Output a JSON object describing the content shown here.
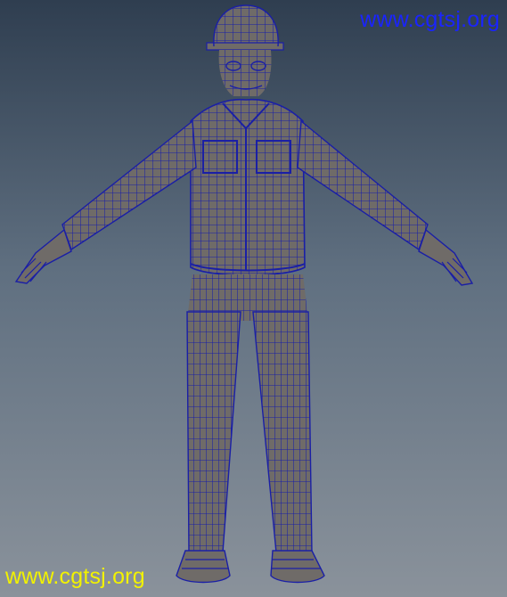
{
  "watermarks": {
    "top": "www.cgtsj.org",
    "bottom": "www.cgtsj.org"
  },
  "colors": {
    "background_top": "#2f3e50",
    "background_bottom": "#8a929b",
    "mesh_fill": "#6f6b68",
    "wireframe": "#1a1fa6",
    "watermark_top": "#1a24ff",
    "watermark_bottom": "#f2f200"
  },
  "model": {
    "pose": "T-pose",
    "subject": "worker-with-helmet",
    "display": "wireframe-on-shaded"
  }
}
